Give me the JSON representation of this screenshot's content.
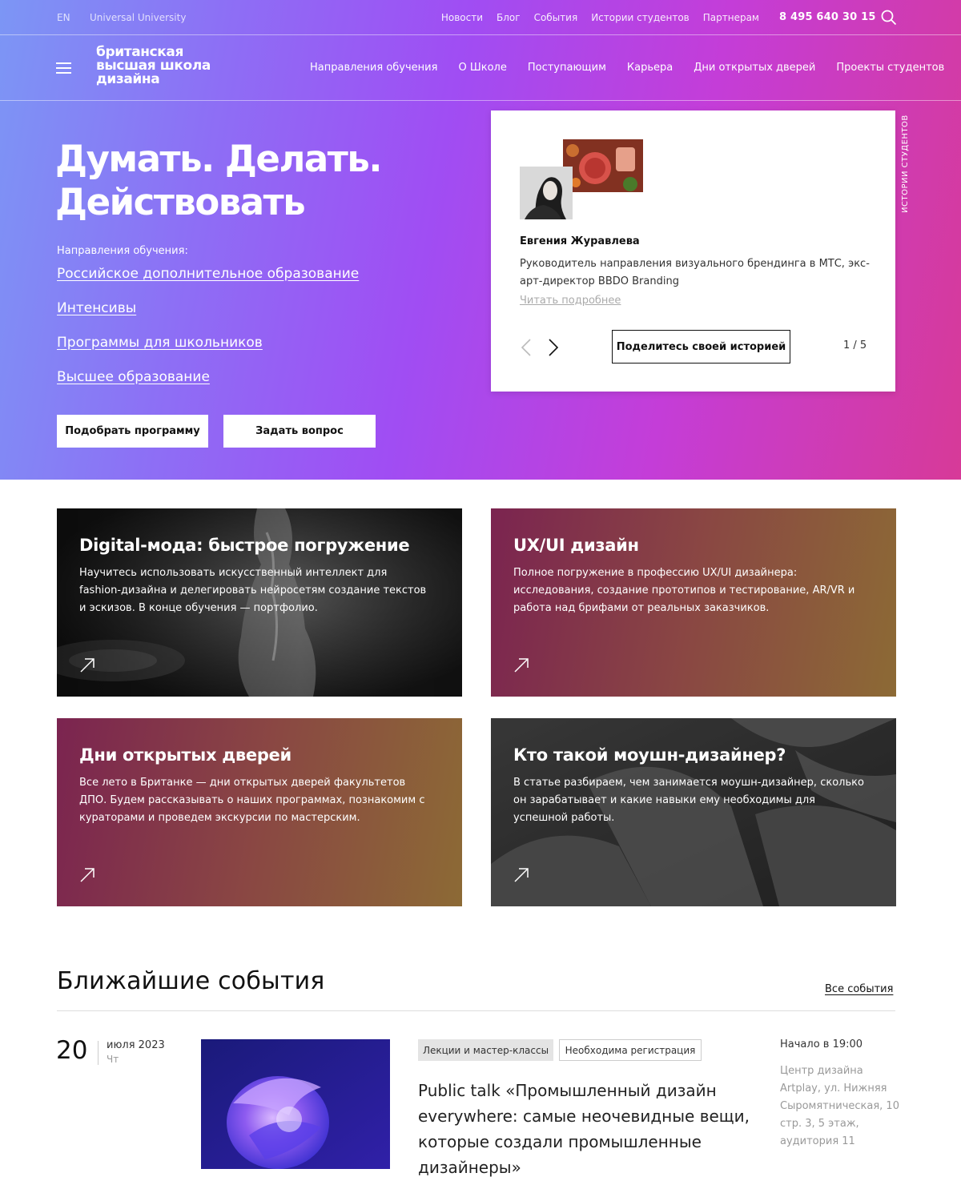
{
  "topbar": {
    "lang": "EN",
    "university": "Universal University",
    "links": [
      "Новости",
      "Блог",
      "События",
      "Истории студентов",
      "Партнерам"
    ],
    "phone": "8 495 640 30 15",
    "search_icon": "search-icon"
  },
  "nav": {
    "logo_lines": [
      "британская",
      "высшая школа",
      "дизайна"
    ],
    "links": [
      "Направления обучения",
      "О Школе",
      "Поступающим",
      "Карьера",
      "Дни открытых дверей",
      "Проекты студентов"
    ]
  },
  "hero": {
    "title_lines": [
      "Думать. Делать.",
      "Действовать"
    ],
    "directions_label": "Направления обучения:",
    "directions": [
      "Российское дополнительное образование",
      "Интенсивы",
      "Программы для школьников",
      "Высшее образование"
    ],
    "pick_button": "Подобрать программу",
    "ask_button": "Задать вопрос"
  },
  "story": {
    "name": "Евгения Журавлева",
    "description": "Руководитель направления визуального брендинга в МТС, экс-арт-директор BBDO Branding",
    "more_link": "Читать подробнее",
    "share_button": "Поделитесь своей историей",
    "pager": "1 / 5",
    "vertical_label": "ИСТОРИИ СТУДЕНТОВ"
  },
  "cards": [
    {
      "title": "Digital-мода: быстрое погружение",
      "text": "Научитесь использовать искусственный интеллект для fashion-дизайна и делегировать нейросетям создание текстов и эскизов. В конце обучения — портфолио."
    },
    {
      "title": "UX/UI дизайн",
      "text": "Полное погружение в профессию UX/UI дизайнера: исследования, создание прототипов и тестирование, AR/VR и работа над брифами от реальных заказчиков."
    },
    {
      "title": "Дни открытых дверей",
      "text": "Все лето в Британке — дни открытых дверей факультетов ДПО. Будем рассказывать о наших программах, познакомим с кураторами и проведем экскурсии по мастерским."
    },
    {
      "title": "Кто такой моушн-дизайнер?",
      "text": "В статье разбираем, чем занимается моушн-дизайнер, сколько он зарабатывает и какие навыки ему необходимы для успешной работы."
    }
  ],
  "events": {
    "title": "Ближайшие события",
    "all_link": "Все события",
    "item": {
      "day": "20",
      "month_year": "июля 2023",
      "weekday": "Чт",
      "tags": [
        "Лекции и мастер-классы",
        "Необходима регистрация"
      ],
      "name": "Public talk «Промышленный дизайн everywhere: самые неочевидные вещи, которые создали промышленные дизайнеры»",
      "time": "Начало в 19:00",
      "place": "Центр дизайна Artplay, ул. Нижняя Сыромятническая, 10 стр. 3, 5 этаж, аудитория 11"
    }
  }
}
